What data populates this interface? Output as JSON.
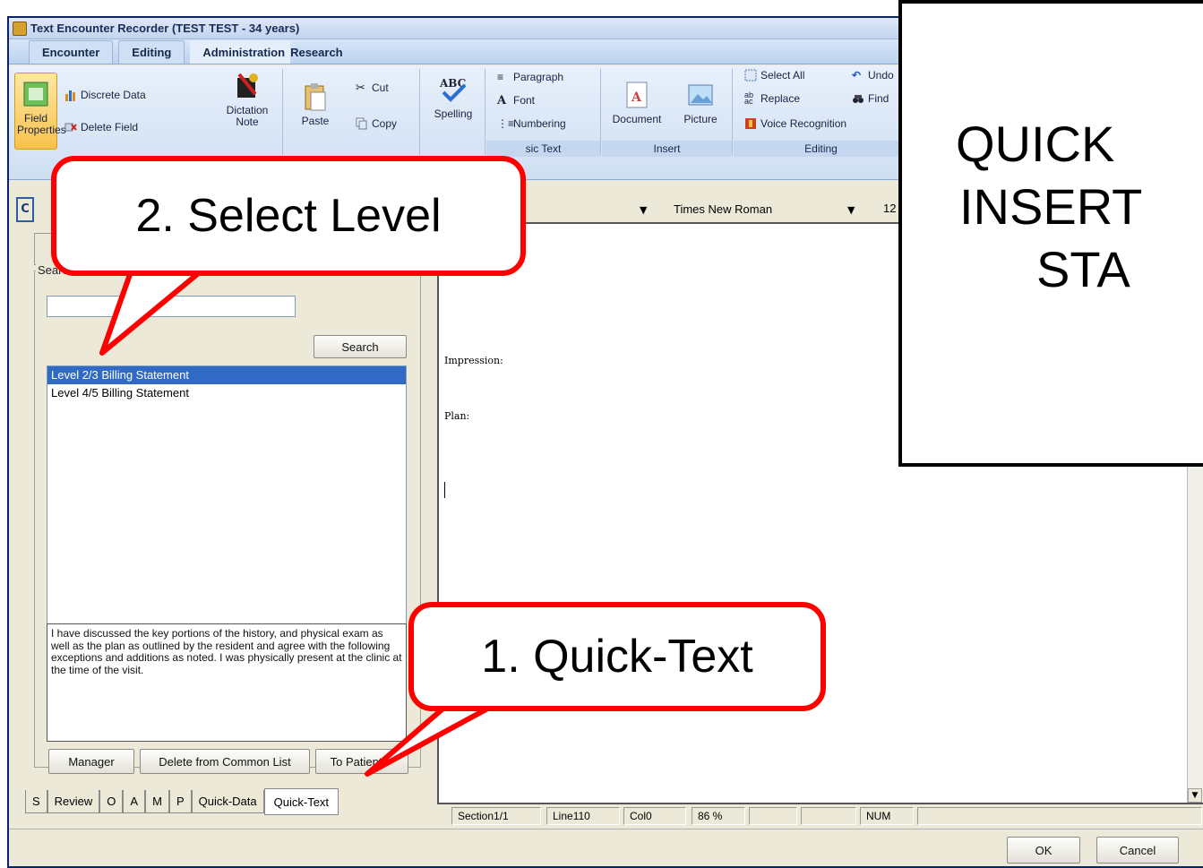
{
  "window": {
    "title": "Text Encounter Recorder (TEST TEST - 34 years)"
  },
  "menu": {
    "tabs": [
      "Encounter",
      "Editing",
      "Administration",
      "Research"
    ]
  },
  "ribbon": {
    "field_properties": "Field Properties",
    "discrete_data": "Discrete Data",
    "delete_field": "Delete Field",
    "dictation_note": "Dictation Note",
    "paste": "Paste",
    "cut": "Cut",
    "copy": "Copy",
    "spelling": "Spelling",
    "paragraph": "Paragraph",
    "font": "Font",
    "numbering": "Numbering",
    "basic_text_label": "sic Text",
    "document": "Document",
    "picture": "Picture",
    "insert_label": "Insert",
    "select_all": "Select All",
    "undo": "Undo",
    "replace": "Replace",
    "find": "Find",
    "voice_recognition": "Voice Recognition",
    "editing_label": "Editing"
  },
  "left_panel": {
    "toolbar_button": "C",
    "search_caption": "Search: Comm",
    "search_input_value": "",
    "search_button": "Search",
    "list_items": [
      "Level 2/3 Billing Statement",
      "Level 4/5 Billing Statement"
    ],
    "preview_text": "I have discussed the key portions of the history, and physical exam as well as the plan as outlined by the resident and agree with the following exceptions and additions as noted. I was physically present at the clinic at the time of the visit.",
    "manager_button": "Manager",
    "delete_button": "Delete from Common List",
    "to_patient_button": "To Patient"
  },
  "bottom_tabs": [
    "S",
    "Review",
    "O",
    "A",
    "M",
    "P",
    "Quick-Data",
    "Quick-Text"
  ],
  "format_bar": {
    "font_name": "Times New Roman",
    "font_size": "12"
  },
  "editor": {
    "impression": "Impression:",
    "plan": "Plan:"
  },
  "status_bar": {
    "section": "Section1/1",
    "line": "Line110",
    "col": "Col0",
    "zoom": "86 %",
    "num": "NUM"
  },
  "footer": {
    "ok": "OK",
    "cancel": "Cancel"
  },
  "overlay": {
    "line1": "QUICK",
    "line2": "INSERT",
    "line3": "STA"
  },
  "callouts": {
    "select_level": "2. Select Level",
    "quick_text": "1. Quick-Text"
  },
  "colors": {
    "callout_border": "#ff0000",
    "selection": "#316ac5",
    "titlebar": "#c2d4ee"
  }
}
